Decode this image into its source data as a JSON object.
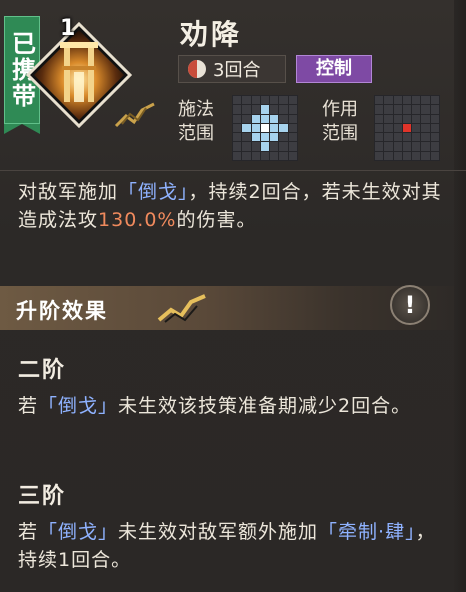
{
  "badge": {
    "label": "已携带"
  },
  "skill": {
    "level": "1",
    "name": "劝降",
    "rounds": "3回合",
    "type_tag": "控制",
    "cast_range_label": "施法\n范围",
    "effect_range_label": "作用\n范围",
    "cast_grid": [
      [
        0,
        0,
        0,
        0,
        0,
        0,
        0
      ],
      [
        0,
        0,
        0,
        1,
        0,
        0,
        0
      ],
      [
        0,
        0,
        1,
        1,
        1,
        0,
        0
      ],
      [
        0,
        1,
        1,
        2,
        1,
        1,
        0
      ],
      [
        0,
        0,
        1,
        1,
        1,
        0,
        0
      ],
      [
        0,
        0,
        0,
        1,
        0,
        0,
        0
      ],
      [
        0,
        0,
        0,
        0,
        0,
        0,
        0
      ]
    ],
    "effect_grid": [
      [
        0,
        0,
        0,
        0,
        0,
        0,
        0
      ],
      [
        0,
        0,
        0,
        0,
        0,
        0,
        0
      ],
      [
        0,
        0,
        0,
        0,
        0,
        0,
        0
      ],
      [
        0,
        0,
        0,
        3,
        0,
        0,
        0
      ],
      [
        0,
        0,
        0,
        0,
        0,
        0,
        0
      ],
      [
        0,
        0,
        0,
        0,
        0,
        0,
        0
      ],
      [
        0,
        0,
        0,
        0,
        0,
        0,
        0
      ]
    ],
    "desc": {
      "p1": "对敌军施加",
      "status": "「倒戈」",
      "p2": "，持续2回合，若未生效对其造成法攻",
      "pct": "130.0%",
      "p3": "的伤害。"
    }
  },
  "upgrade": {
    "title": "升阶效果",
    "info_icon": "!"
  },
  "tiers": [
    {
      "title": "二阶",
      "pre": "若",
      "status": "「倒戈」",
      "post": "未生效该技策准备期减少2回合。"
    },
    {
      "title": "三阶",
      "pre": "若",
      "status": "「倒戈」",
      "mid": "未生效对敌军额外施加",
      "status2": "「牵制·肆」",
      "post": "，持续1回合。"
    }
  ],
  "colors": {
    "accent_blue": "#8fb2ff",
    "highlight": "#f08a5d",
    "tag_purple": "#7e4aa4",
    "badge_green": "#2f8a55"
  }
}
